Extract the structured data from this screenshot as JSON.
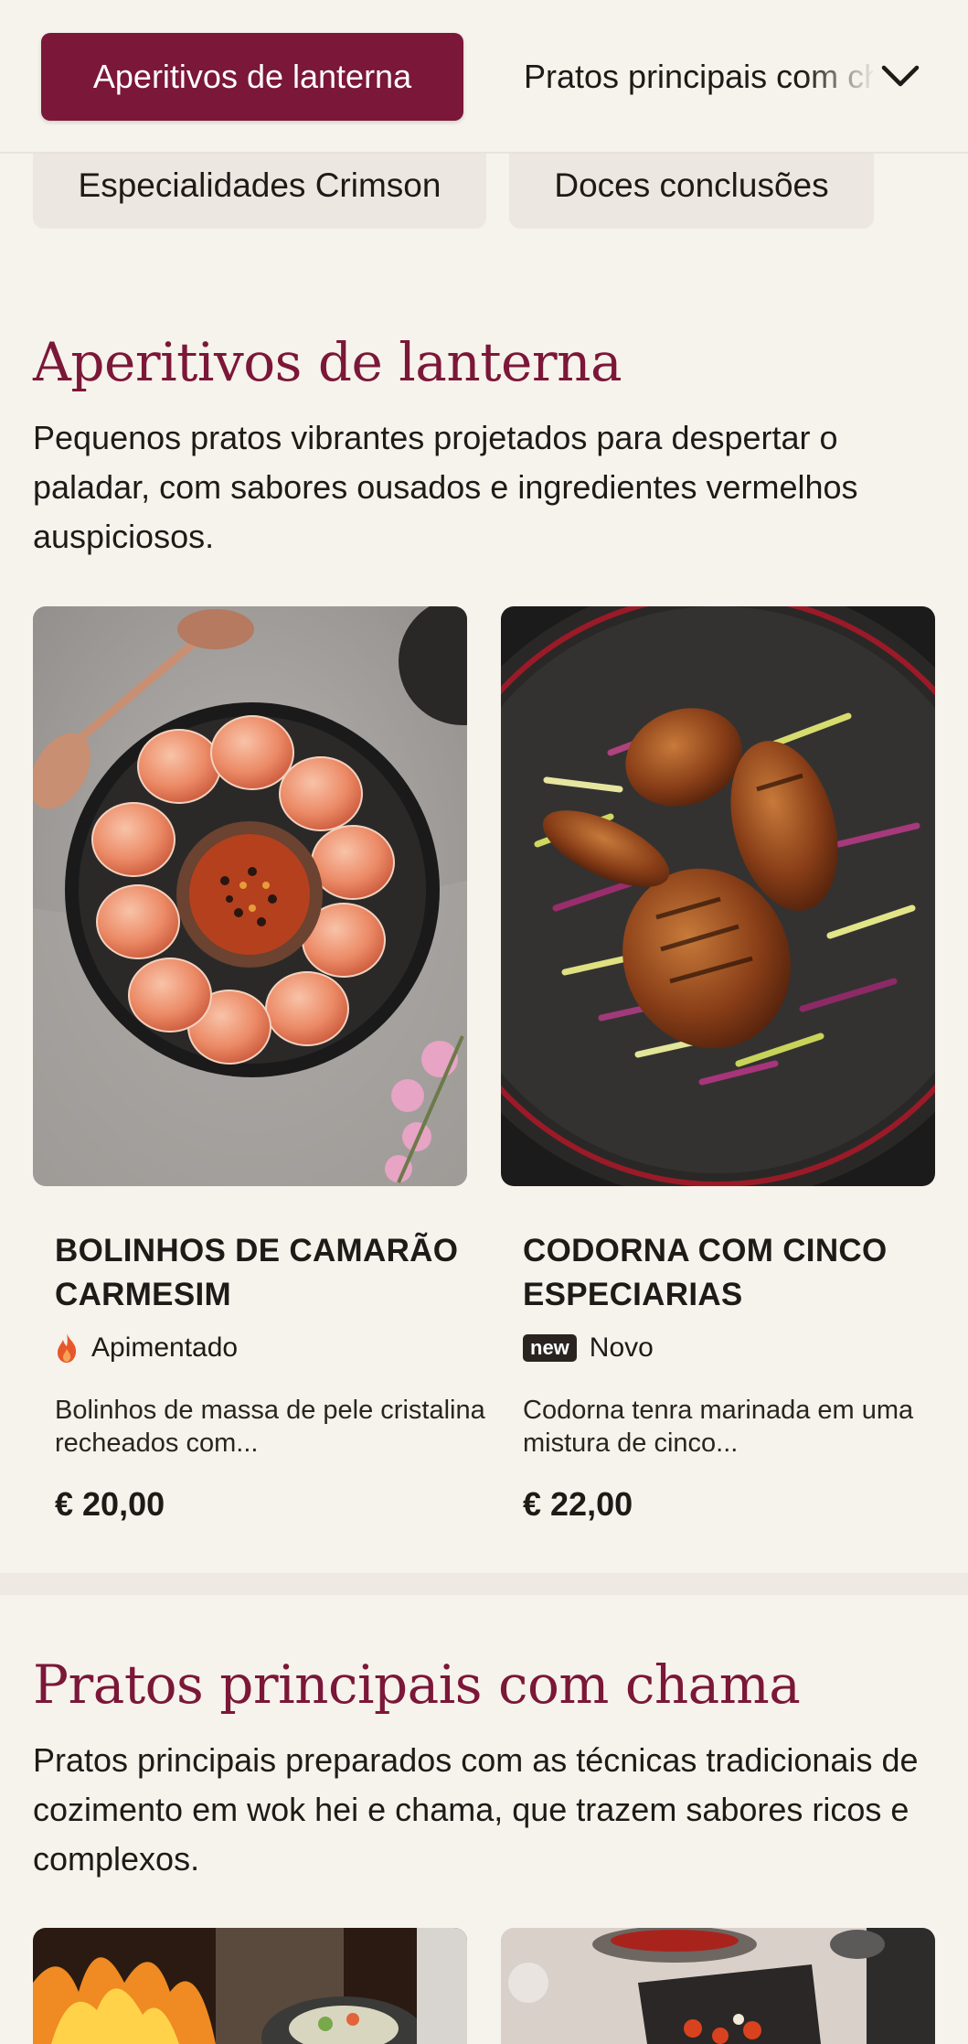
{
  "nav": {
    "active_tab": "Aperitivos de lanterna",
    "next_tab": "Pratos principais com chama",
    "row2": [
      "Especialidades Crimson",
      "Doces conclusões"
    ]
  },
  "sections": [
    {
      "title": "Aperitivos de lanterna",
      "description": "Pequenos pratos vibrantes projetados para despertar o paladar, com sabores ousados e ingredientes vermelhos auspiciosos.",
      "dishes": [
        {
          "name": "BOLINHOS DE CAMARÃO CARMESIM",
          "tag": "Apimentado",
          "tag_icon": "flame-icon",
          "description": "Bolinhos de massa de pele cristalina recheados com...",
          "price": "€ 20,00"
        },
        {
          "name": "CODORNA COM CINCO ESPECIARIAS",
          "tag_badge": "new",
          "tag": "Novo",
          "description": "Codorna tenra marinada em uma mistura de cinco...",
          "price": "€ 22,00"
        }
      ]
    },
    {
      "title": "Pratos principais com chama",
      "description": "Pratos principais preparados com as técnicas tradicionais de cozimento em wok hei e chama, que trazem sabores ricos e complexos."
    }
  ],
  "colors": {
    "accent": "#7b1738",
    "background": "#f6f2ec",
    "pill_inactive": "#ede7e1",
    "text": "#1f1a17"
  }
}
